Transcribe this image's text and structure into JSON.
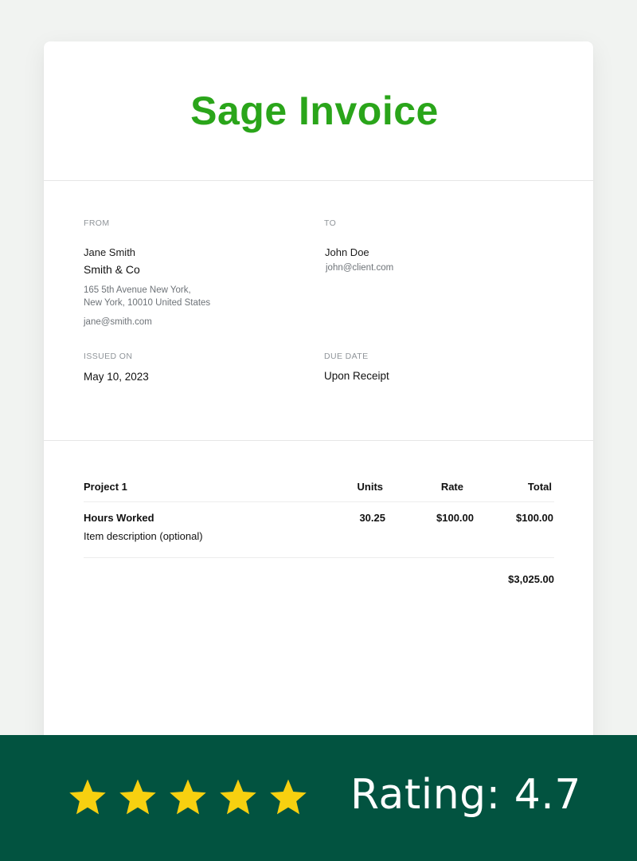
{
  "invoice": {
    "title": "Sage Invoice",
    "brand_color": "#2aa51a",
    "from": {
      "label": "FROM",
      "name": "Jane Smith",
      "company": "Smith & Co",
      "address_line1": "165 5th Avenue New York,",
      "address_line2": "New York, 10010 United States",
      "email": "jane@smith.com"
    },
    "to": {
      "label": "TO",
      "name": "John Doe",
      "email": "john@client.com"
    },
    "issued": {
      "label": "ISSUED ON",
      "value": "May 10, 2023"
    },
    "due": {
      "label": "DUE DATE",
      "value": "Upon Receipt"
    },
    "table": {
      "headers": [
        "Project 1",
        "Units",
        "Rate",
        "Total"
      ],
      "rows": [
        {
          "item": "Hours Worked",
          "description": "Item description (optional)",
          "units": "30.25",
          "rate": "$100.00",
          "total": "$100.00"
        }
      ],
      "grand_total": "$3,025.00"
    }
  },
  "banner": {
    "background": "#025340",
    "star_color": "#f7d010",
    "stars_count": 5,
    "stars_icon": "star-icon",
    "rating_text": "Rating: 4.7"
  }
}
